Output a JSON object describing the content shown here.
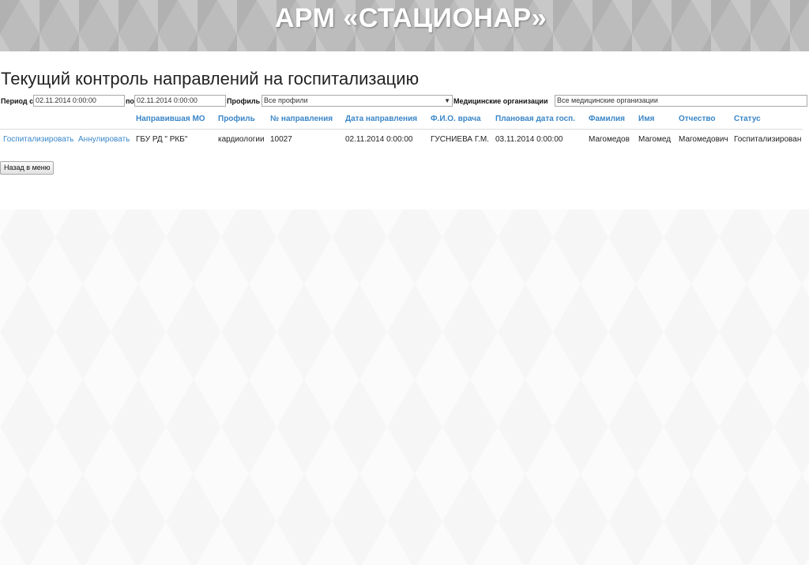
{
  "banner": {
    "title": "АРМ «СТАЦИОНАР»"
  },
  "page": {
    "title": "Текущий контроль направлений на госпитализацию"
  },
  "filters": {
    "period_from_label": "Период с",
    "period_from_value": "02.11.2014 0:00:00",
    "period_to_label": "по",
    "period_to_value": "02.11.2014 0:00:00",
    "profile_label": "Профиль",
    "profile_value": "Все профили",
    "org_label": "Медицинские организации",
    "org_value": "Все медицинские организации"
  },
  "table": {
    "columns": [
      "Направившая МО",
      "Профиль",
      "№ направления",
      "Дата направления",
      "Ф.И.О. врача",
      "Плановая дата госп.",
      "Фамилия",
      "Имя",
      "Отчество",
      "Статус"
    ],
    "rows": [
      {
        "action_hospitalize": "Госпитализировать",
        "action_cancel": "Аннулировать",
        "mo": "ГБУ РД \" РКБ\"",
        "profile": "кардиологии",
        "number": "10027",
        "date": "02.11.2014 0:00:00",
        "doctor": "ГУСНИЕВА Г.М.",
        "planned_date": "03.11.2014 0:00:00",
        "surname": "Магомедов",
        "name": "Магомед",
        "patronymic": "Магомедович",
        "status": "Госпитализирован"
      }
    ]
  },
  "actions": {
    "back_label": "Назад в меню"
  }
}
